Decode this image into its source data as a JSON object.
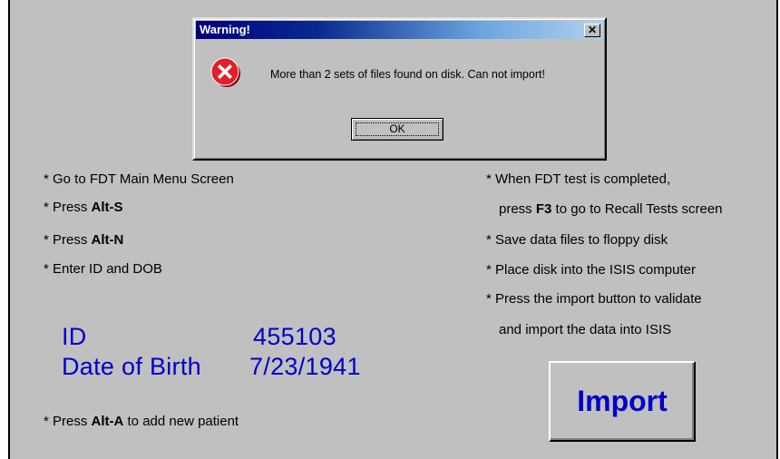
{
  "instructions_left": [
    {
      "prefix": "* Go to FDT Main Menu Screen",
      "key": "",
      "suffix": ""
    },
    {
      "prefix": "* Press ",
      "key": "Alt-S",
      "suffix": ""
    },
    {
      "prefix": "* Press ",
      "key": "Alt-N",
      "suffix": ""
    },
    {
      "prefix": "* Enter ID and DOB",
      "key": "",
      "suffix": ""
    }
  ],
  "instructions_right": [
    {
      "prefix": "* When FDT test is completed,",
      "key": "",
      "suffix": ""
    },
    {
      "prefix": "press ",
      "key": "F3",
      "suffix": " to go to Recall Tests screen"
    },
    {
      "prefix": "* Save data files to floppy disk",
      "key": "",
      "suffix": ""
    },
    {
      "prefix": "* Place disk into the ISIS computer",
      "key": "",
      "suffix": ""
    },
    {
      "prefix": "* Press the import button to validate",
      "key": "",
      "suffix": ""
    },
    {
      "prefix": "and import the data into ISIS",
      "key": "",
      "suffix": ""
    }
  ],
  "patient": {
    "id_label": "ID",
    "id_value": "455103",
    "dob_label": "Date of Birth",
    "dob_value": "7/23/1941"
  },
  "add_patient": {
    "prefix": "* Press ",
    "key": "Alt-A",
    "suffix": " to add new patient"
  },
  "import_button": "Import",
  "dialog": {
    "title": "Warning!",
    "close_label": "✕",
    "icon": "error-icon",
    "message": "More than 2 sets of files found on disk. Can not import!",
    "ok_label": "OK"
  },
  "colors": {
    "accent": "#0000cc",
    "background": "#c0c0c0",
    "title_bar": "#000080",
    "error": "#e0202a"
  }
}
